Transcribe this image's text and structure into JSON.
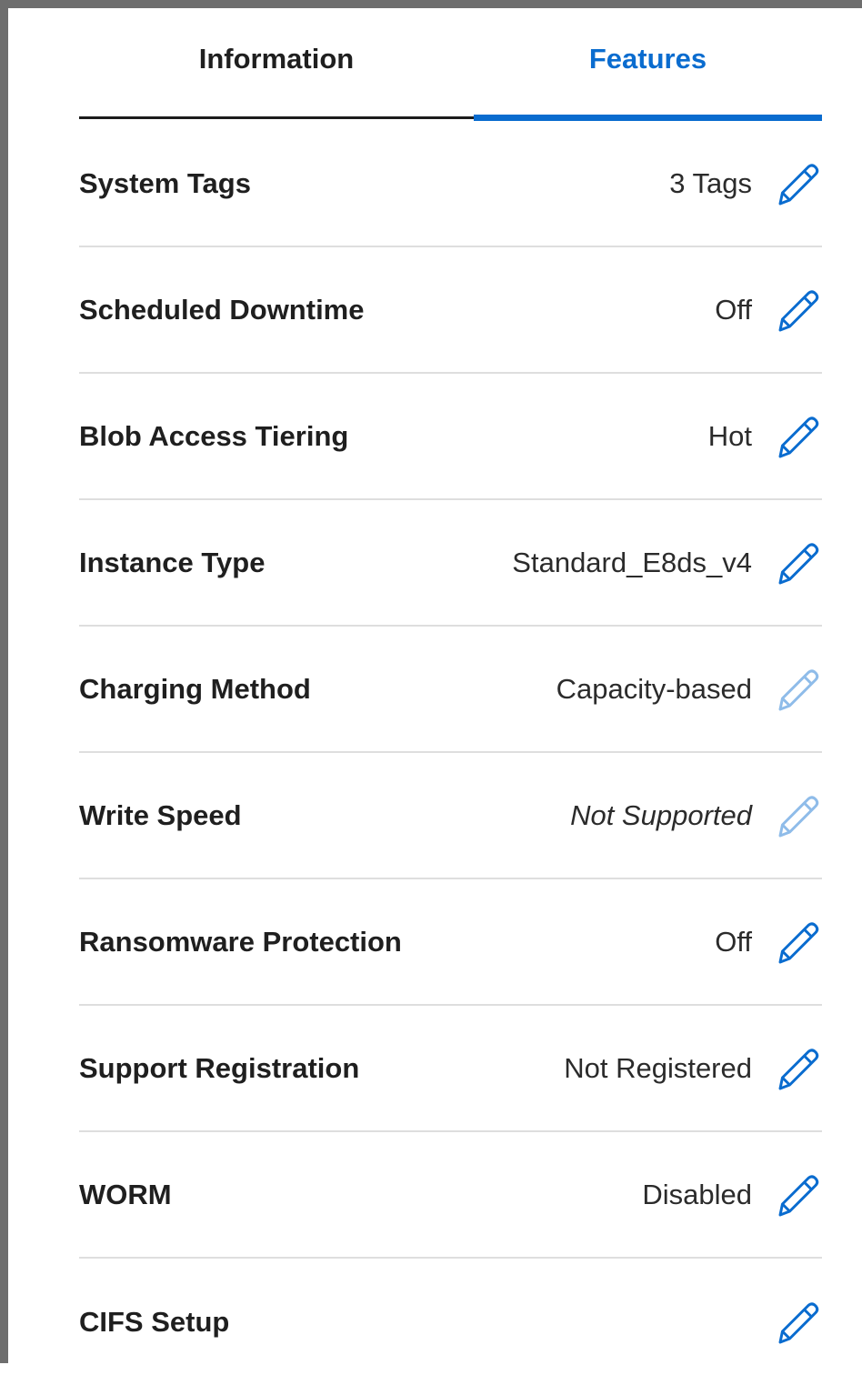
{
  "tabs": [
    {
      "label": "Information",
      "active": false
    },
    {
      "label": "Features",
      "active": true
    }
  ],
  "rows": [
    {
      "label": "System Tags",
      "value": "3 Tags",
      "italic": false,
      "editable": true
    },
    {
      "label": "Scheduled Downtime",
      "value": "Off",
      "italic": false,
      "editable": true
    },
    {
      "label": "Blob Access Tiering",
      "value": "Hot",
      "italic": false,
      "editable": true
    },
    {
      "label": "Instance Type",
      "value": "Standard_E8ds_v4",
      "italic": false,
      "editable": true
    },
    {
      "label": "Charging Method",
      "value": "Capacity-based",
      "italic": false,
      "editable": false
    },
    {
      "label": "Write Speed",
      "value": "Not Supported",
      "italic": true,
      "editable": false
    },
    {
      "label": "Ransomware Protection",
      "value": "Off",
      "italic": false,
      "editable": true
    },
    {
      "label": "Support Registration",
      "value": "Not Registered",
      "italic": false,
      "editable": true
    },
    {
      "label": "WORM",
      "value": "Disabled",
      "italic": false,
      "editable": true
    },
    {
      "label": "CIFS Setup",
      "value": "",
      "italic": false,
      "editable": true
    }
  ],
  "icons": {
    "edit": "pencil-icon"
  },
  "colors": {
    "accent": "#0a6ccf",
    "text": "#1f1f1f",
    "divider": "#dedede",
    "frame": "#6e6e6e"
  }
}
